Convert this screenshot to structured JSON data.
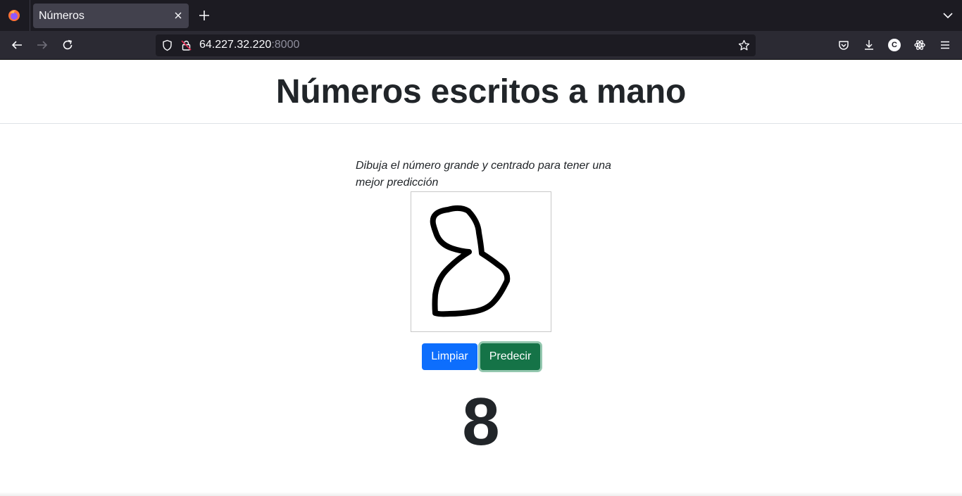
{
  "browser": {
    "tab_title": "Números",
    "url_host": "64.227.32.220",
    "url_port": ":8000",
    "profile_initial": "C"
  },
  "icons": {
    "browser_logo": "firefox-icon",
    "tab_close": "close-icon",
    "new_tab": "plus-icon",
    "tab_list": "chevron-down-icon",
    "back": "arrow-left-icon",
    "forward": "arrow-right-icon",
    "reload": "reload-icon",
    "tracking": "shield-icon",
    "insecure": "lock-slash-icon",
    "bookmark": "star-icon",
    "pocket": "pocket-icon",
    "downloads": "download-icon",
    "extension": "atom-icon",
    "menu": "hamburger-icon"
  },
  "page": {
    "title": "Números escritos a mano",
    "instructions": "Dibuja el número grande y centrado para tener una mejor predicción",
    "clear_button": "Limpiar",
    "predict_button": "Predecir",
    "prediction": "8"
  },
  "colors": {
    "chrome_dark": "#1c1b22",
    "chrome_toolbar": "#2b2a33",
    "primary_button": "#0d6efd",
    "success_button": "#157347",
    "text": "#212529"
  }
}
